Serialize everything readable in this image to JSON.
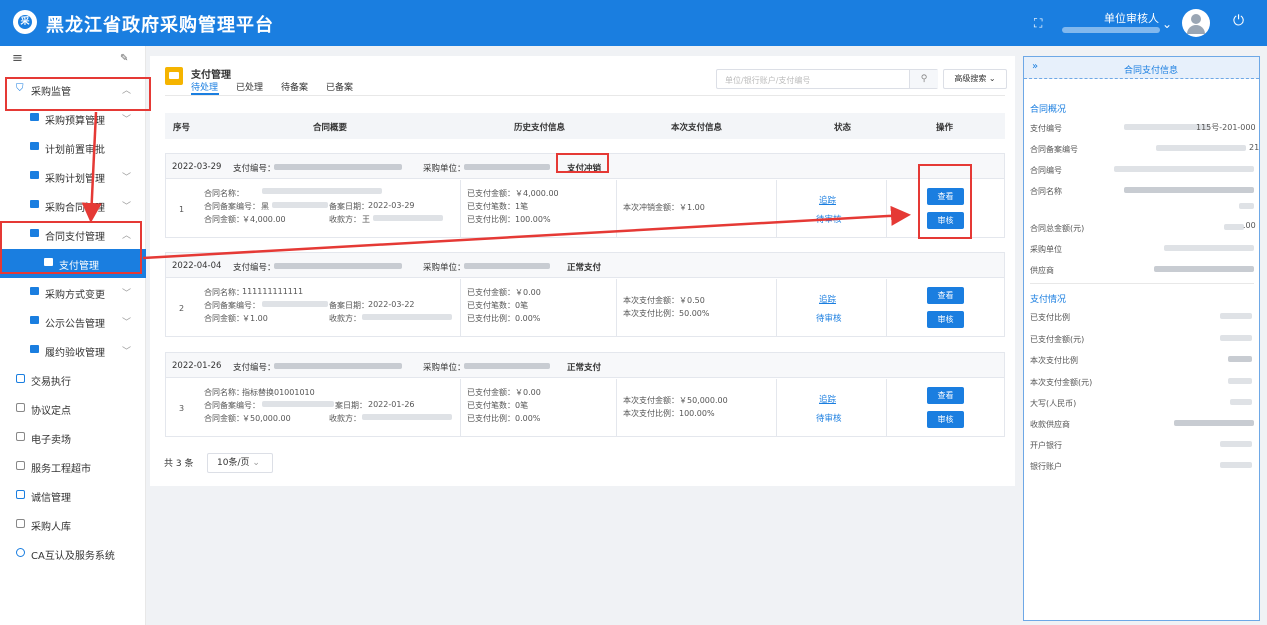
{
  "app": {
    "title": "黑龙江省政府采购管理平台",
    "logo_char": "采"
  },
  "header": {
    "user_role": "单位审核人"
  },
  "sidebar": {
    "items": [
      {
        "label": "采购监管"
      },
      {
        "label": "采购预算管理"
      },
      {
        "label": "计划前置审批"
      },
      {
        "label": "采购计划管理"
      },
      {
        "label": "采购合同管理"
      },
      {
        "label": "合同支付管理"
      },
      {
        "label": "支付管理"
      },
      {
        "label": "采购方式变更"
      },
      {
        "label": "公示公告管理"
      },
      {
        "label": "履约验收管理"
      },
      {
        "label": "交易执行"
      },
      {
        "label": "协议定点"
      },
      {
        "label": "电子卖场"
      },
      {
        "label": "服务工程超市"
      },
      {
        "label": "诚信管理"
      },
      {
        "label": "采购人库"
      },
      {
        "label": "CA互认及服务系统"
      }
    ]
  },
  "main": {
    "title": "支付管理",
    "tabs": [
      "待处理",
      "已处理",
      "待备案",
      "已备案"
    ],
    "active_tab": "待处理",
    "search_placeholder": "单位/银行账户/支付编号",
    "advanced_search": "高级搜索",
    "columns": [
      "序号",
      "合同概要",
      "历史支付信息",
      "本次支付信息",
      "状态",
      "操作"
    ],
    "records": [
      {
        "date": "2022-03-29",
        "pay_no_label": "支付编号：",
        "unit_label": "采购单位：",
        "pay_type": "支付冲销",
        "index": "1",
        "contract_name_label": "合同名称：",
        "record_no_label": "合同备案编号：",
        "record_no_prefix": "黑",
        "record_date_label": "备案日期：",
        "record_date": "2022-03-29",
        "amount_label": "合同金额：",
        "amount": "￥4,000.00",
        "payee_label": "收款方：",
        "payee_prefix": "王",
        "hist_paid": "已支付金额：￥4,000.00",
        "hist_count": "已支付笔数：1笔",
        "hist_ratio": "已支付比例：100.00%",
        "cur_lines": [
          "本次冲销金额：￥1.00"
        ],
        "track": "追踪",
        "status": "待审核",
        "view": "查看",
        "audit": "审核"
      },
      {
        "date": "2022-04-04",
        "pay_no_label": "支付编号：",
        "unit_label": "采购单位：",
        "pay_type": "正常支付",
        "index": "2",
        "contract_name_label": "合同名称：",
        "contract_name": "111111111111",
        "record_no_label": "合同备案编号：",
        "record_date_label": "备案日期：",
        "record_date": "2022-03-22",
        "amount_label": "合同金额：",
        "amount": "￥1.00",
        "payee_label": "收款方：",
        "hist_paid": "已支付金额：￥0.00",
        "hist_count": "已支付笔数：0笔",
        "hist_ratio": "已支付比例：0.00%",
        "cur_lines": [
          "本次支付金额：￥0.50",
          "本次支付比例：50.00%"
        ],
        "track": "追踪",
        "status": "待审核",
        "view": "查看",
        "audit": "审核"
      },
      {
        "date": "2022-01-26",
        "pay_no_label": "支付编号：",
        "unit_label": "采购单位：",
        "pay_type": "正常支付",
        "index": "3",
        "contract_name_label": "合同名称：",
        "contract_name": "指标替换01001010",
        "record_no_label": "合同备案编号：",
        "record_date_label": "案日期：",
        "record_date": "2022-01-26",
        "amount_label": "合同金额：",
        "amount": "￥50,000.00",
        "payee_label": "收款方：",
        "hist_paid": "已支付金额：￥0.00",
        "hist_count": "已支付笔数：0笔",
        "hist_ratio": "已支付比例：0.00%",
        "cur_lines": [
          "本次支付金额：￥50,000.00",
          "本次支付比例：100.00%"
        ],
        "track": "追踪",
        "status": "待审核",
        "view": "查看",
        "audit": "审核"
      }
    ],
    "total": "共 3 条",
    "page_size": "10条/页"
  },
  "right_panel": {
    "title": "合同支付信息",
    "overview_title": "合同概况",
    "overview_labels": [
      "支付编号",
      "合同备案编号",
      "合同编号",
      "合同名称",
      "合同总金额(元)",
      "采购单位",
      "供应商"
    ],
    "overview_visible_values": [
      "115号-201-000",
      "21",
      "",
      "",
      ".00",
      "",
      ""
    ],
    "payment_title": "支付情况",
    "payment_labels": [
      "已支付比例",
      "已支付金额(元)",
      "本次支付比例",
      "本次支付金额(元)",
      "大写(人民币)",
      "收款供应商",
      "开户银行",
      "银行账户"
    ]
  }
}
